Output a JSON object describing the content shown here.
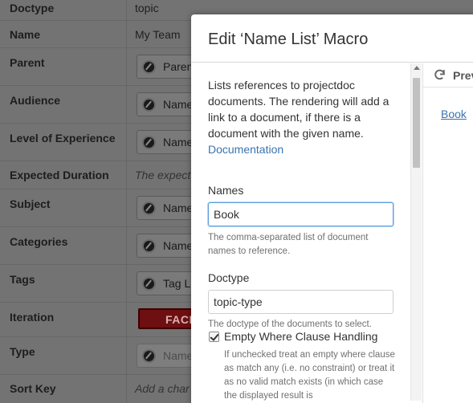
{
  "background": {
    "rows": [
      {
        "label": "Doctype",
        "value": "topic",
        "kind": "text"
      },
      {
        "label": "Name",
        "value": "My Team",
        "kind": "text"
      },
      {
        "label": "Parent",
        "value": "Paren",
        "kind": "chip"
      },
      {
        "label": "Audience",
        "value": "Name",
        "kind": "chip"
      },
      {
        "label": "Level of Experience",
        "value": "Name",
        "kind": "chip"
      },
      {
        "label": "Expected Duration",
        "value": "The expect",
        "kind": "placeholder"
      },
      {
        "label": "Subject",
        "value": "Name",
        "kind": "chip"
      },
      {
        "label": "Categories",
        "value": "Name",
        "kind": "chip"
      },
      {
        "label": "Tags",
        "value": "Tag Li",
        "kind": "chip"
      },
      {
        "label": "Iteration",
        "value": "FACE",
        "kind": "badge"
      },
      {
        "label": "Type",
        "value": "Name",
        "kind": "chip-faded"
      },
      {
        "label": "Sort Key",
        "value": "Add a char",
        "kind": "placeholder"
      }
    ]
  },
  "dialog": {
    "title": "Edit ‘Name List’ Macro",
    "description": "Lists references to projectdoc documents. The rendering will add a link to a document, if there is a document with the given name.",
    "documentation_link": "Documentation",
    "fields": {
      "names": {
        "label": "Names",
        "value": "Book",
        "help": "The comma-separated list of document names to reference."
      },
      "doctype": {
        "label": "Doctype",
        "value": "topic-type",
        "help": "The doctype of the documents to select."
      },
      "empty_where": {
        "label": "Empty Where Clause Handling",
        "checked": true,
        "help": "If unchecked treat an empty where clause as match any (i.e. no constraint) or treat it as no valid match exists (in which case the displayed result is"
      }
    },
    "preview": {
      "label": "Previ",
      "link": "Book",
      "refresh_icon": "refresh-icon"
    }
  },
  "colors": {
    "link": "#3b73af",
    "focus": "#5c9edd",
    "overlay": "#737373",
    "badge": "#6e0f12"
  }
}
